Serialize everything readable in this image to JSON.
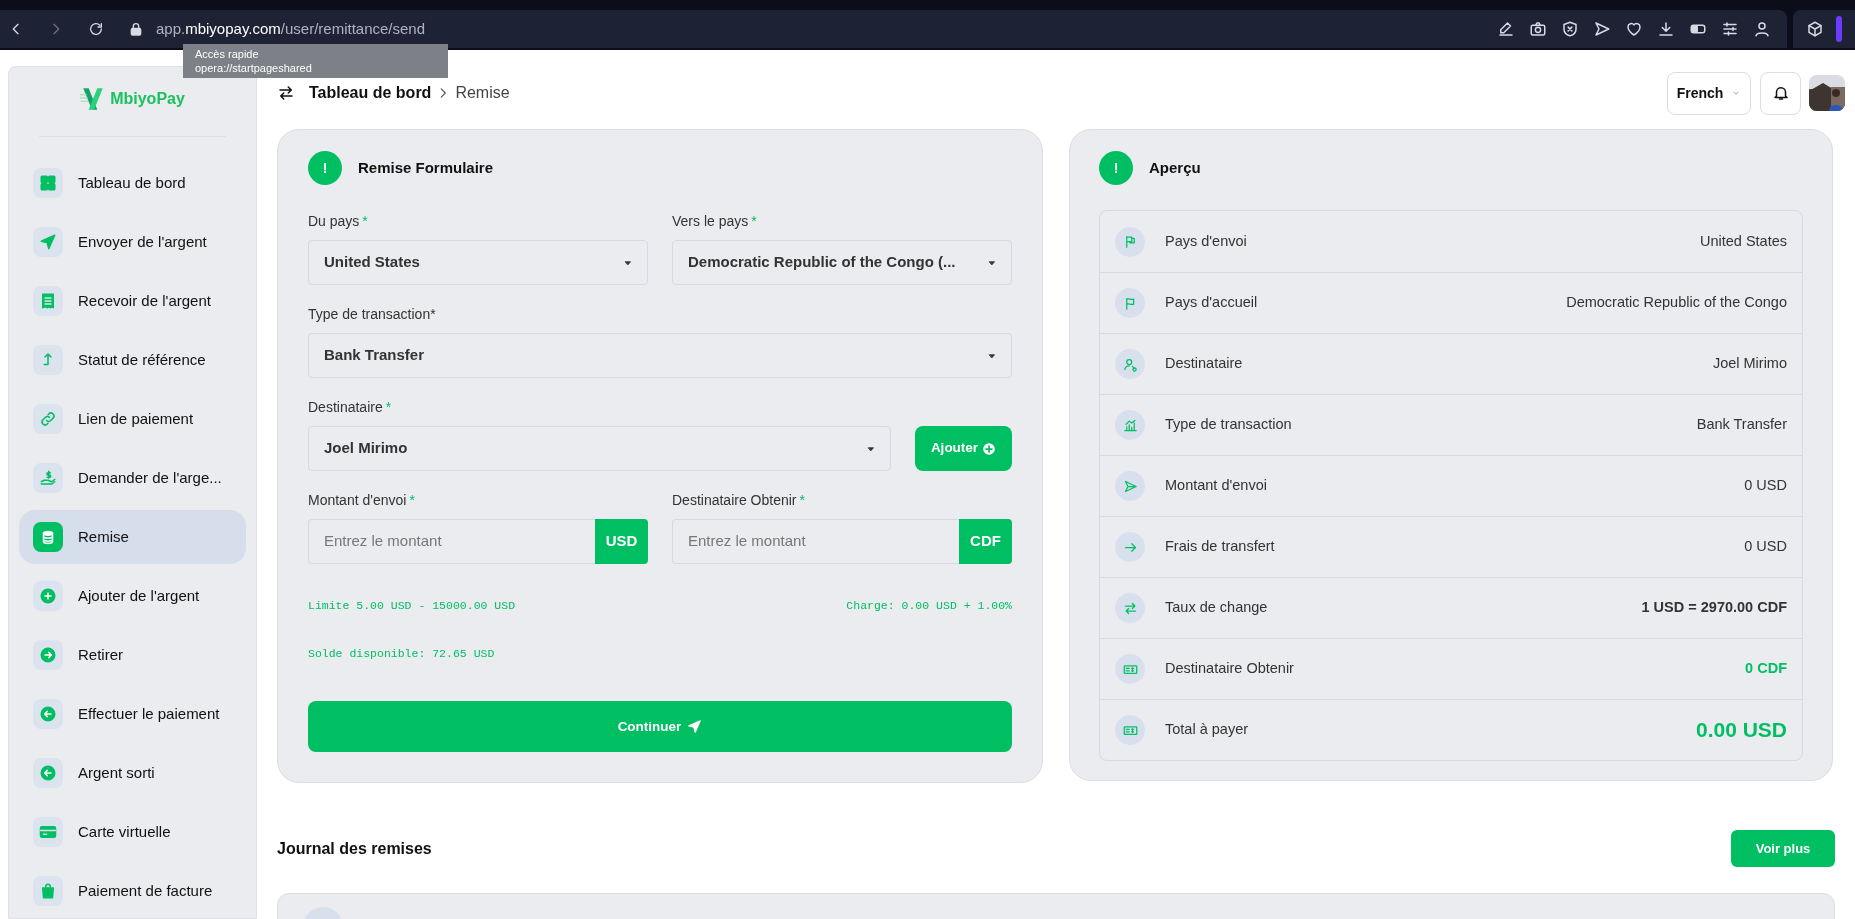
{
  "browser": {
    "url_parts": [
      {
        "text": "app.",
        "highlighted": false
      },
      {
        "text": "mbiyopay.com",
        "highlighted": true
      },
      {
        "text": "/user/remittance/send",
        "highlighted": false
      }
    ]
  },
  "tooltip": {
    "title": "Accès rapide",
    "subtitle": "opera://startpageshared"
  },
  "sidebar": {
    "logo": "MbiyoPay",
    "items": [
      {
        "label": "Tableau de bord",
        "selected": false
      },
      {
        "label": "Envoyer de l'argent",
        "selected": false
      },
      {
        "label": "Recevoir de l'argent",
        "selected": false
      },
      {
        "label": "Statut de référence",
        "selected": false
      },
      {
        "label": "Lien de paiement",
        "selected": false
      },
      {
        "label": "Demander de l'arge...",
        "selected": false
      },
      {
        "label": "Remise",
        "selected": true
      },
      {
        "label": "Ajouter de l'argent",
        "selected": false
      },
      {
        "label": "Retirer",
        "selected": false
      },
      {
        "label": "Effectuer le paiement",
        "selected": false
      },
      {
        "label": "Argent sorti",
        "selected": false
      },
      {
        "label": "Carte virtuelle",
        "selected": false
      },
      {
        "label": "Paiement de facture",
        "selected": false
      }
    ]
  },
  "header": {
    "breadcrumb": [
      "Tableau de bord",
      "Remise"
    ],
    "language": "French"
  },
  "form": {
    "badge": "!",
    "title": "Remise Formulaire",
    "from_country": {
      "label": "Du pays",
      "mark": "*",
      "value": "United States"
    },
    "to_country": {
      "label": "Vers le pays",
      "mark": "*",
      "value": "Democratic Republic of the Congo (..."
    },
    "transaction_type": {
      "label": "Type de transaction*",
      "value": "Bank Transfer"
    },
    "recipient": {
      "label": "Destinataire",
      "mark": "*",
      "value": "Joel Mirimo"
    },
    "add_button": "Ajouter",
    "send_amount": {
      "label": "Montant d'envoi",
      "mark": "*",
      "placeholder": "Entrez le montant",
      "currency": "USD"
    },
    "receive_amount": {
      "label": "Destinataire Obtenir",
      "mark": "*",
      "placeholder": "Entrez le montant",
      "currency": "CDF"
    },
    "limit": "Limite 5.00 USD - 15000.00 USD",
    "charge": "Charge: 0.00 USD + 1.00%",
    "balance": "Solde disponible: 72.65 USD",
    "submit": "Continuer"
  },
  "preview": {
    "badge": "!",
    "title": "Aperçu",
    "rows": [
      {
        "label": "Pays d'envoi",
        "value": "United States",
        "kind": "plain"
      },
      {
        "label": "Pays d'accueil",
        "value": "Democratic Republic of the Congo",
        "kind": "plain"
      },
      {
        "label": "Destinataire",
        "value": "Joel Mirimo",
        "kind": "plain"
      },
      {
        "label": "Type de transaction",
        "value": "Bank Transfer",
        "kind": "plain"
      },
      {
        "label": "Montant d'envoi",
        "value": "0 USD",
        "kind": "plain"
      },
      {
        "label": "Frais de transfert",
        "value": "0 USD",
        "kind": "plain"
      },
      {
        "label": "Taux de change",
        "value": "1 USD = 2970.00 CDF",
        "kind": "bold"
      },
      {
        "label": "Destinataire Obtenir",
        "value": "0 CDF",
        "kind": "accent"
      },
      {
        "label": "Total à payer",
        "value": "0.00 USD",
        "kind": "total"
      }
    ]
  },
  "journal": {
    "title": "Journal des remises",
    "button": "Voir plus"
  }
}
